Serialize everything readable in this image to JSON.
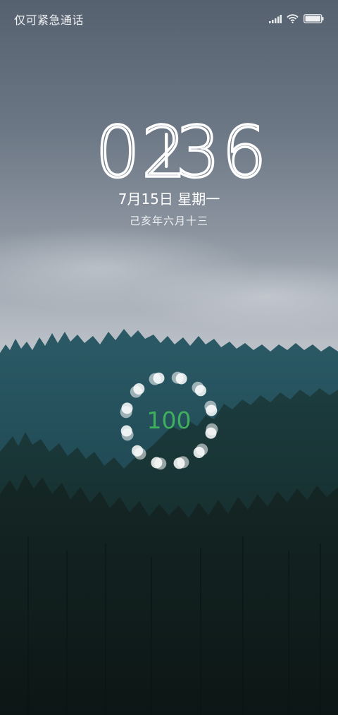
{
  "status_bar": {
    "carrier_text": "仅可紧急通话",
    "signal_icon": "signal-bars-icon",
    "wifi_icon": "wifi-icon",
    "battery_icon": "battery-icon",
    "battery_level": 1.0
  },
  "clock": {
    "hours": "02",
    "minutes": "36"
  },
  "date": {
    "date_text": "7月15日 星期一",
    "lunar_text": "己亥年六月十三"
  },
  "charging": {
    "value": "100",
    "value_color": "#3fae5d",
    "ring_icon": "charging-dots-ring-icon"
  },
  "colors": {
    "sky_top": "#5e6b7a",
    "sky_mid": "#b7bcc4",
    "forest_dark": "#0f1d1c",
    "forest_teal": "#27535e"
  }
}
